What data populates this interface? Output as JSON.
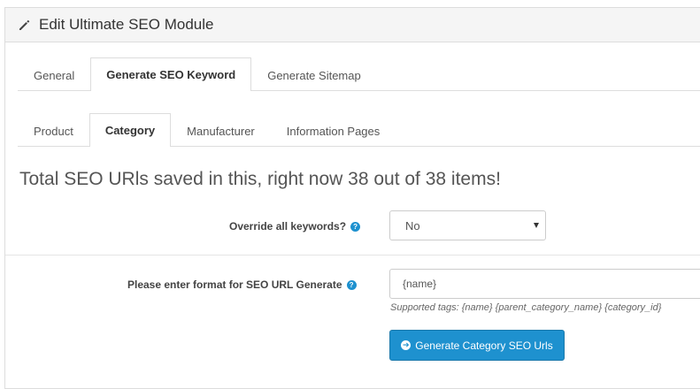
{
  "panel": {
    "title": "Edit Ultimate SEO Module",
    "title_icon": "pencil-icon"
  },
  "main_tabs": [
    {
      "label": "General",
      "active": false
    },
    {
      "label": "Generate SEO Keyword",
      "active": true
    },
    {
      "label": "Generate Sitemap",
      "active": false
    }
  ],
  "sub_tabs": [
    {
      "label": "Product",
      "active": false
    },
    {
      "label": "Category",
      "active": true
    },
    {
      "label": "Manufacturer",
      "active": false
    },
    {
      "label": "Information Pages",
      "active": false
    }
  ],
  "content": {
    "headline": "Total SEO URls saved in this, right now 38 out of 38 items!",
    "override_label": "Override all keywords?",
    "override_value": "No",
    "format_label": "Please enter format for SEO URL Generate",
    "format_value": "{name}",
    "supported_tags": "Supported tags: {name} {parent_category_name} {category_id}",
    "generate_button": "Generate Category SEO Urls"
  },
  "colors": {
    "primary": "#1e91cf",
    "heading_bg": "#f5f5f5",
    "border": "#dddddd"
  }
}
